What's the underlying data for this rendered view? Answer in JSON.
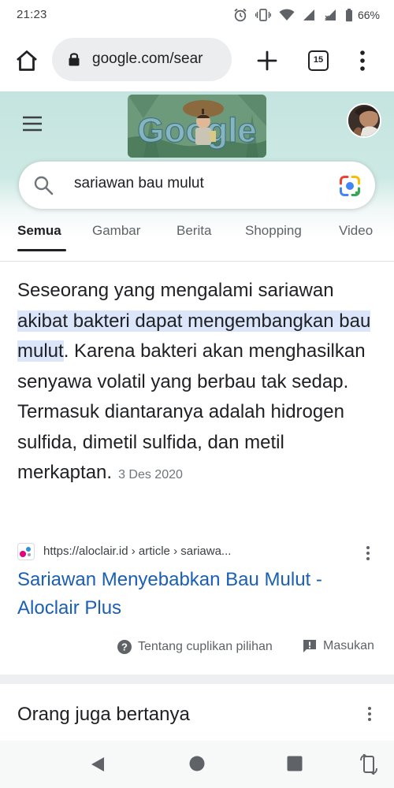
{
  "status_bar": {
    "time": "21:23",
    "battery": "66%",
    "icons": [
      "alarm-icon",
      "vibrate-icon",
      "wifi-icon",
      "signal-icon",
      "signal-no-data-icon",
      "battery-icon"
    ]
  },
  "browser": {
    "url": "google.com/sear",
    "tab_count": "15"
  },
  "header": {
    "logo_text": "Google"
  },
  "search": {
    "query": "sariawan bau mulut"
  },
  "tabs": [
    "Semua",
    "Gambar",
    "Berita",
    "Shopping",
    "Video"
  ],
  "snippet": {
    "text_before": "Seseorang yang mengalami sariawan ",
    "highlight": "akibat bakteri dapat mengembangkan bau mulut",
    "text_after": ". Karena bakteri akan menghasilkan senyawa volatil yang berbau tak sedap. Termasuk diantaranya adalah hidrogen sulfida, dimetil sulfida, dan metil merkaptan.",
    "date": "3 Des 2020"
  },
  "result": {
    "url": "https://aloclair.id › article › sariawa...",
    "title": "Sariawan Menyebabkan Bau Mulut - Aloclair Plus"
  },
  "footer_links": {
    "about": "Tentang cuplikan pilihan",
    "feedback": "Masukan"
  },
  "people_also_ask": {
    "title": "Orang juga bertanya"
  },
  "colors": {
    "highlight": "#dbe6fb",
    "link": "#1a5fb4",
    "header_bg": "#c5e4df"
  }
}
